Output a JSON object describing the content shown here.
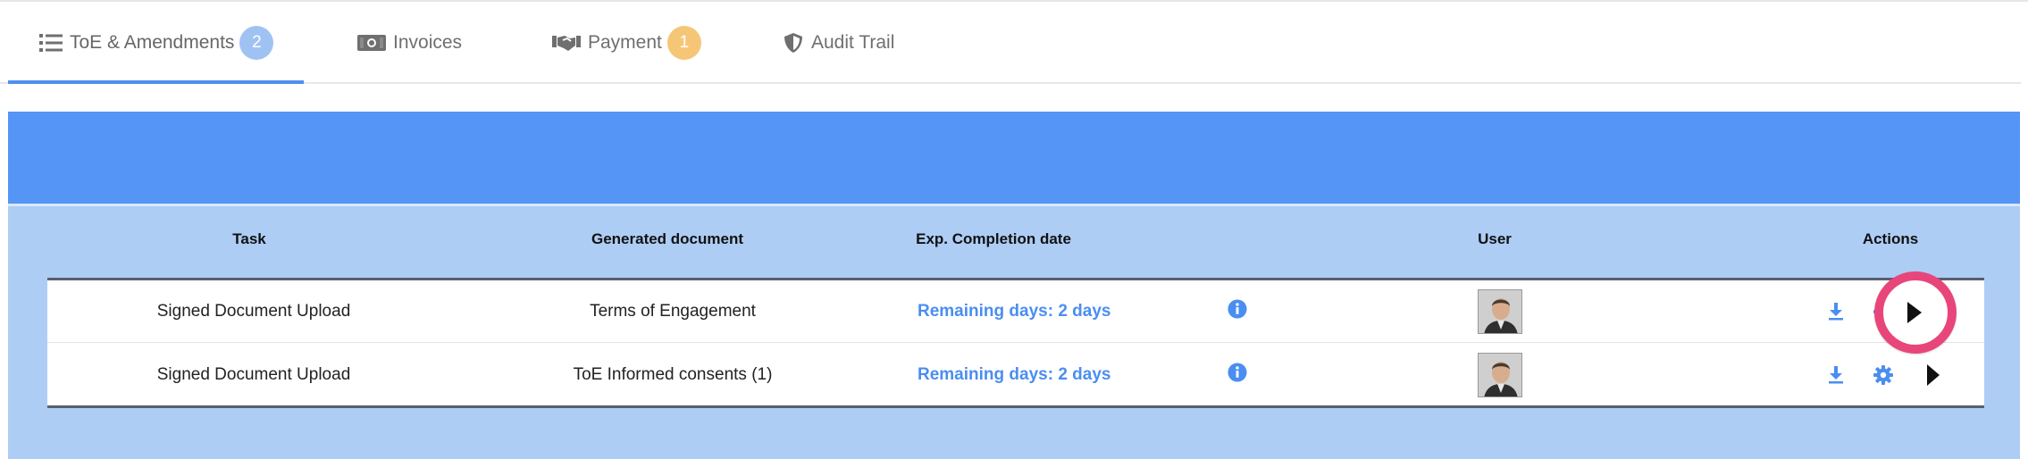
{
  "tabs": [
    {
      "label": "ToE & Amendments",
      "badge": "2",
      "icon": "list-icon",
      "active": true
    },
    {
      "label": "Invoices",
      "badge": null,
      "icon": "money-bill-icon",
      "active": false
    },
    {
      "label": "Payment",
      "badge": "1",
      "icon": "handshake-icon",
      "active": false
    },
    {
      "label": "Audit Trail",
      "badge": null,
      "icon": "shield-icon",
      "active": false
    }
  ],
  "table": {
    "columns": {
      "task": "Task",
      "document": "Generated document",
      "completion": "Exp. Completion date",
      "user": "User",
      "actions": "Actions"
    },
    "rows": [
      {
        "task": "Signed Document Upload",
        "document": "Terms of Engagement",
        "completion": "Remaining days: 2 days"
      },
      {
        "task": "Signed Document Upload",
        "document": "ToE Informed consents (1)",
        "completion": "Remaining days: 2 days"
      }
    ]
  },
  "colors": {
    "accent": "#4f8fef",
    "panel_header": "#5495f5",
    "panel_body": "#aecdf5",
    "highlight": "#e8467a",
    "badge_blue": "#9fc2f3",
    "badge_orange": "#f6c677"
  }
}
